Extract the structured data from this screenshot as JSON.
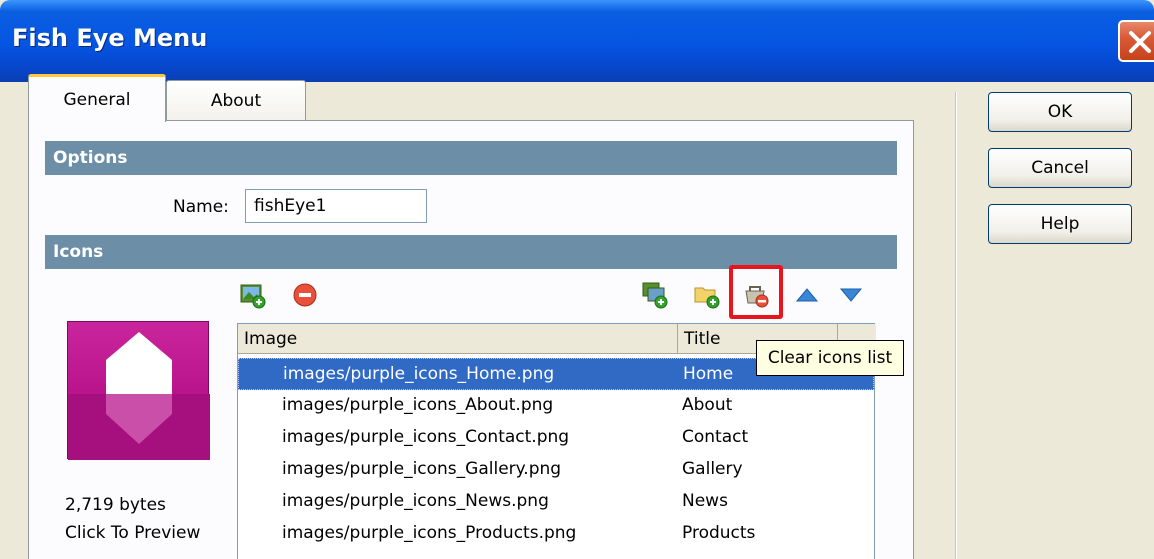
{
  "window": {
    "title": "Fish Eye Menu"
  },
  "tabs": [
    {
      "label": "General",
      "active": true
    },
    {
      "label": "About",
      "active": false
    }
  ],
  "options": {
    "header": "Options",
    "name_label": "Name:",
    "name_value": "fishEye1"
  },
  "icons": {
    "header": "Icons",
    "toolbar": {
      "left": [
        "add-image-icon",
        "remove-icon"
      ],
      "right": [
        "add-multiple-images-icon",
        "add-folder-icon",
        "clear-list-icon",
        "move-up-icon",
        "move-down-icon"
      ]
    },
    "preview": {
      "size": "2,719 bytes",
      "hint": "Click To Preview"
    },
    "columns": {
      "image": "Image",
      "title": "Title"
    },
    "rows": [
      {
        "image": "images/purple_icons_Home.png",
        "title": "Home",
        "selected": true
      },
      {
        "image": "images/purple_icons_About.png",
        "title": "About",
        "selected": false
      },
      {
        "image": "images/purple_icons_Contact.png",
        "title": "Contact",
        "selected": false
      },
      {
        "image": "images/purple_icons_Gallery.png",
        "title": "Gallery",
        "selected": false
      },
      {
        "image": "images/purple_icons_News.png",
        "title": "News",
        "selected": false
      },
      {
        "image": "images/purple_icons_Products.png",
        "title": "Products",
        "selected": false
      }
    ],
    "tooltip": "Clear icons list"
  },
  "buttons": {
    "ok": "OK",
    "cancel": "Cancel",
    "help": "Help"
  },
  "colors": {
    "titlebar": "#0554e3",
    "section_header": "#6c8ea6",
    "selection": "#316ac5",
    "highlight": "#e8141e",
    "preview": "#b9138c"
  }
}
